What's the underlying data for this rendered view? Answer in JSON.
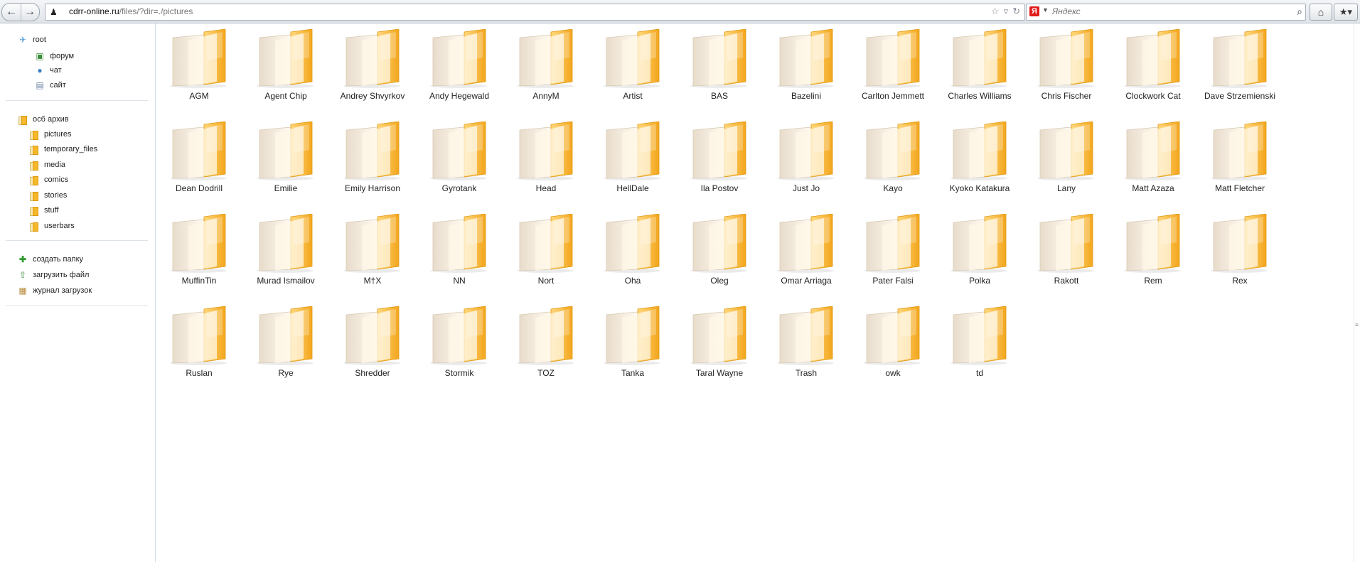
{
  "browser": {
    "url_domain": "cdrr-online.ru",
    "url_path": "/files/?dir=./pictures",
    "search_placeholder": "Яндекс",
    "search_engine_letter": "Я"
  },
  "sidebar": {
    "root_label": "root",
    "root_children": [
      "форум",
      "чат",
      "сайт"
    ],
    "archive_label": "осб архив",
    "archive_children": [
      "pictures",
      "temporary_files",
      "media",
      "comics",
      "stories",
      "stuff",
      "userbars"
    ],
    "actions": [
      "создать папку",
      "загрузить файл",
      "журнал загрузок"
    ]
  },
  "folders": [
    [
      "AGM",
      "Agent Chip",
      "Andrey Shvyrkov",
      "Andy Hegewald",
      "AnnyM",
      "Artist",
      "BAS",
      "Bazelini",
      "Carlton Jemmett",
      "Charles Williams",
      "Chris Fischer",
      "Clockwork Cat",
      "Dave Strzemienski"
    ],
    [
      "Dean Dodrill",
      "Emilie",
      "Emily Harrison",
      "Gyrotank",
      "Head",
      "HellDale",
      "Ila Postov",
      "Just Jo",
      "Kayo",
      "Kyoko Katakura",
      "Lany",
      "Matt Azaza",
      "Matt Fletcher"
    ],
    [
      "MuffinTin",
      "Murad Ismailov",
      "M†X",
      "NN",
      "Nort",
      "Oha",
      "Oleg",
      "Omar Arriaga",
      "Pater Falsi",
      "Polka",
      "Rakott",
      "Rem",
      "Rex"
    ],
    [
      "Ruslan",
      "Rye",
      "Shredder",
      "Stormik",
      "TOZ",
      "Tanka",
      "Taral Wayne",
      "Trash",
      "owk",
      "td"
    ]
  ],
  "colors": {
    "folder_front": "#f8b52a",
    "folder_back": "#f9efdd",
    "sidebar_border": "#cfe0ea"
  }
}
